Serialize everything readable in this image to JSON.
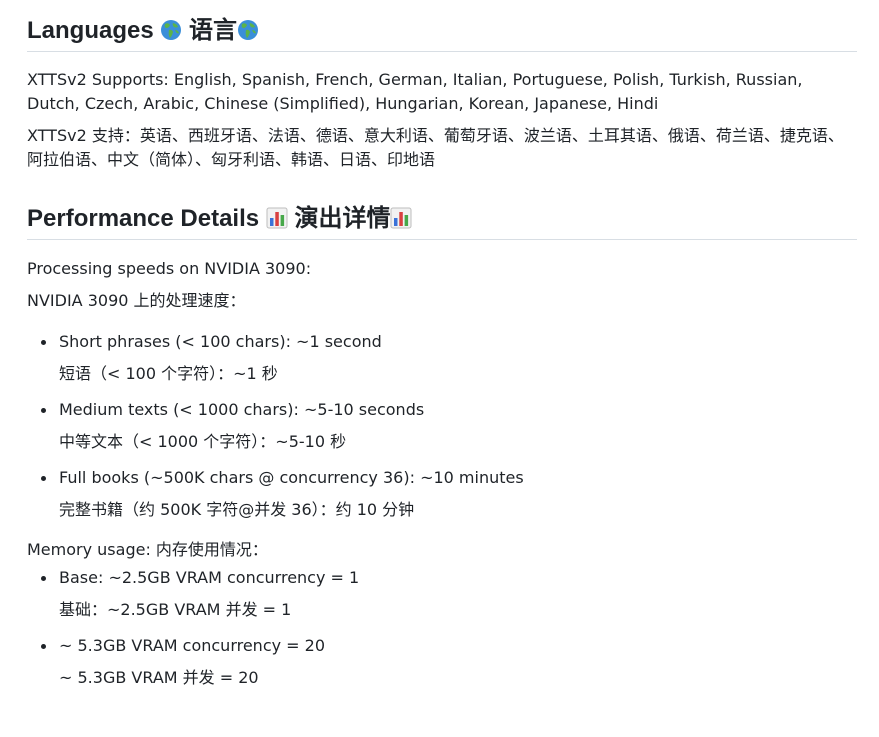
{
  "languages_section": {
    "heading_en": "Languages",
    "heading_zh": "语言",
    "icon": "globe-icon",
    "supports_en": "XTTSv2 Supports: English, Spanish, French, German, Italian, Portuguese, Polish, Turkish, Russian, Dutch, Czech, Arabic, Chinese (Simplified), Hungarian, Korean, Japanese, Hindi",
    "supports_zh": "XTTSv2 支持：英语、西班牙语、法语、德语、意大利语、葡萄牙语、波兰语、土耳其语、俄语、荷兰语、捷克语、阿拉伯语、中文（简体）、匈牙利语、韩语、日语、印地语"
  },
  "performance_section": {
    "heading_en": "Performance Details",
    "heading_zh": "演出详情",
    "icon": "bar-chart-icon",
    "processing_en": "Processing speeds on NVIDIA 3090:",
    "processing_zh": "NVIDIA 3090 上的处理速度：",
    "speed_items": [
      {
        "en": "Short phrases (< 100 chars): ~1 second",
        "zh": "短语（< 100 个字符）：~1 秒"
      },
      {
        "en": "Medium texts (< 1000 chars): ~5-10 seconds",
        "zh": "中等文本（< 1000 个字符）：~5-10 秒"
      },
      {
        "en": "Full books (~500K chars @ concurrency 36): ~10 minutes",
        "zh": "完整书籍（约 500K 字符@并发 36）：约 10 分钟"
      }
    ],
    "memory_label": "Memory usage: 内存使用情况：",
    "memory_items": [
      {
        "en": "Base: ~2.5GB VRAM concurrency = 1",
        "zh": "基础：~2.5GB VRAM 并发 = 1"
      },
      {
        "en": "~ 5.3GB VRAM concurrency = 20",
        "zh": "~ 5.3GB VRAM 并发 = 20"
      }
    ]
  },
  "colors": {
    "text": "#1f2328",
    "rule": "#d8dee4"
  }
}
